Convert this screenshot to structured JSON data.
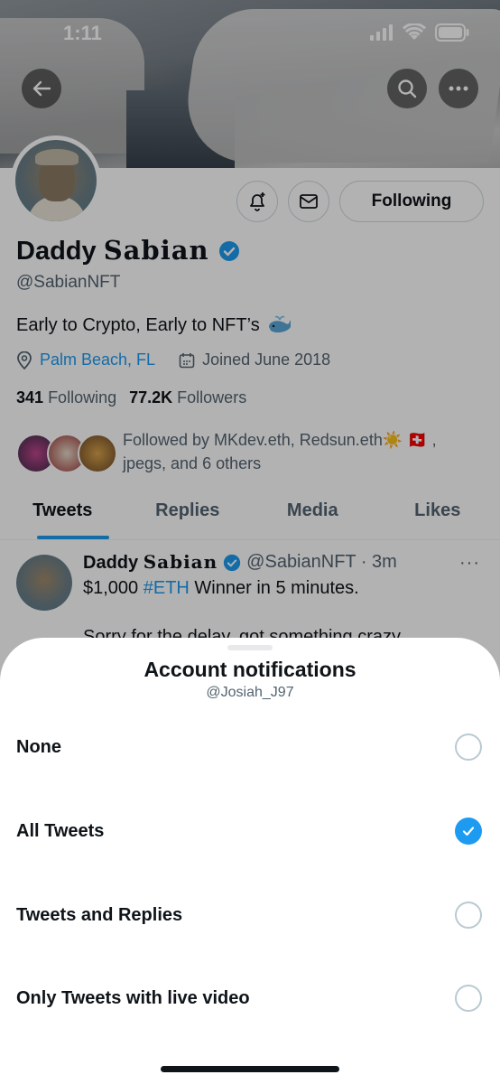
{
  "status_bar": {
    "time": "1:11"
  },
  "profile": {
    "display_name_main": "Daddy ",
    "display_name_gothic": "Sabian",
    "handle": "@SabianNFT",
    "bio": "Early to Crypto, Early to NFT’s",
    "location": "Palm Beach, FL",
    "joined": "Joined June 2018",
    "following_count": "341",
    "following_label": "Following",
    "followers_count": "77.2K",
    "followers_label": "Followers",
    "followed_by": "Followed by MKdev.eth, Redsun.eth☀️ 🇨🇭 , jpegs, and 6 others",
    "following_button": "Following"
  },
  "tabs": [
    "Tweets",
    "Replies",
    "Media",
    "Likes"
  ],
  "tweet": {
    "name_main": "Daddy ",
    "name_gothic": "Sabian",
    "handle_time": "@SabianNFT · 3m",
    "text_prefix": "$1,000 ",
    "hashtag": "#ETH",
    "text_suffix": " Winner in 5 minutes.",
    "text_line2": "Sorry for the delay, got something crazy",
    "more": "···"
  },
  "sheet": {
    "title": "Account notifications",
    "subtitle": "@Josiah_J97",
    "options": [
      {
        "label": "None",
        "selected": false
      },
      {
        "label": "All Tweets",
        "selected": true
      },
      {
        "label": "Tweets and Replies",
        "selected": false
      },
      {
        "label": "Only Tweets with live video",
        "selected": false
      }
    ]
  },
  "colors": {
    "accent": "#1d9bf0",
    "text": "#0f1419",
    "secondary": "#536471"
  }
}
